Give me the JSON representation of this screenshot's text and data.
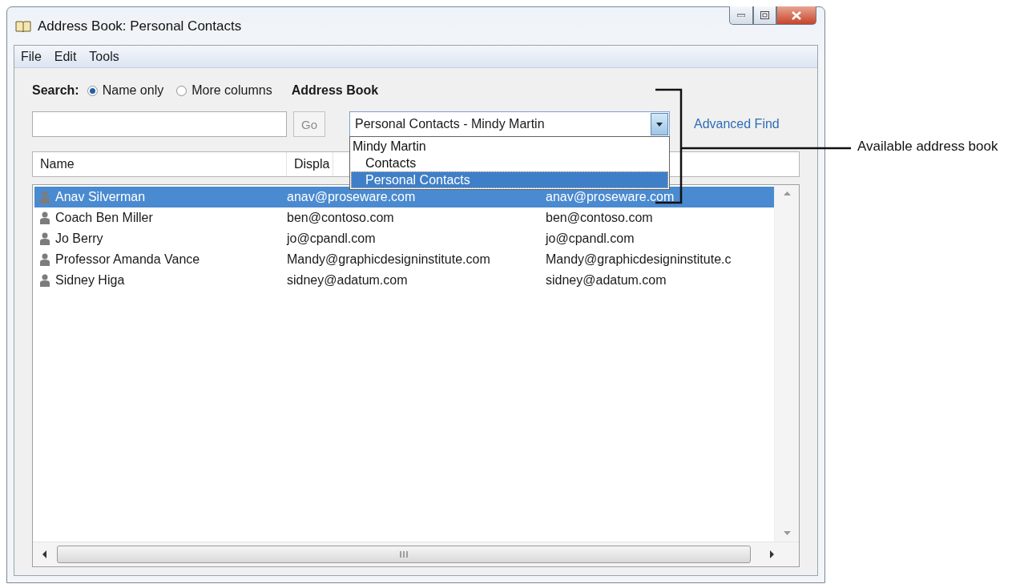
{
  "window": {
    "title": "Address Book: Personal Contacts"
  },
  "menu": [
    {
      "label": "File"
    },
    {
      "label": "Edit"
    },
    {
      "label": "Tools"
    }
  ],
  "search": {
    "label": "Search:",
    "options": [
      {
        "label": "Name only",
        "selected": true
      },
      {
        "label": "More columns",
        "selected": false
      }
    ],
    "go_button": {
      "label": "Go",
      "disabled": true
    }
  },
  "address_book": {
    "label": "Address Book",
    "value": "Personal Contacts - Mindy Martin",
    "expanded": true,
    "items": [
      {
        "label": "Mindy Martin",
        "selected": false,
        "children": [
          {
            "label": "Contacts",
            "selected": false
          },
          {
            "label": "Personal Contacts",
            "selected": true
          }
        ]
      }
    ]
  },
  "advanced_find": {
    "label": "Advanced Find"
  },
  "table": {
    "columns": [
      "Name",
      "Displa"
    ],
    "rows": [
      {
        "name": "Anav Silverman",
        "display": "anav@proseware.com",
        "column_3": "anav@proseware.com",
        "selected": true
      },
      {
        "name": "Coach Ben Miller",
        "display": "ben@contoso.com",
        "column_3": "ben@contoso.com",
        "selected": false
      },
      {
        "name": "Jo Berry",
        "display": "jo@cpandl.com",
        "column_3": "jo@cpandl.com",
        "selected": false
      },
      {
        "name": "Professor Amanda Vance",
        "display": "Mandy@graphicdesigninstitute.com",
        "column_3": "Mandy@graphicdesigninstitute.c",
        "selected": false
      },
      {
        "name": "Sidney Higa",
        "display": "sidney@adatum.com",
        "column_3": "sidney@adatum.com",
        "selected": false
      }
    ]
  },
  "callout": {
    "label": "Available address book"
  }
}
